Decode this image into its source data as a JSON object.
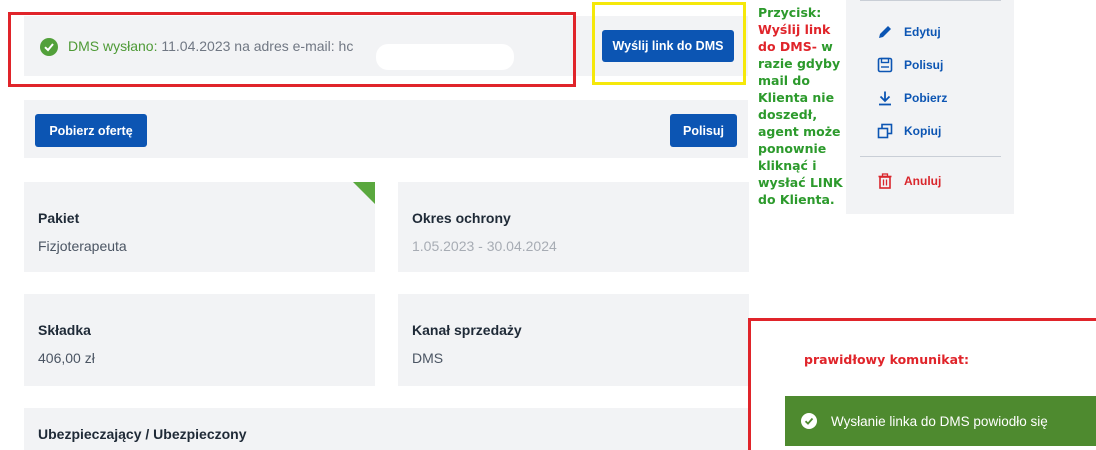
{
  "status": {
    "prefix": "DMS wysłano:",
    "text": " 11.04.2023 na adres e-mail: hc"
  },
  "buttons": {
    "send_link": "Wyślij link do DMS",
    "download_offer": "Pobierz ofertę",
    "polisuj": "Polisuj"
  },
  "cards": {
    "pakiet": {
      "label": "Pakiet",
      "value": "Fizjoterapeuta"
    },
    "okres": {
      "label": "Okres ochrony",
      "value": "1.05.2023 - 30.04.2024"
    },
    "skladka": {
      "label": "Składka",
      "value": "406,00 zł"
    },
    "kanal": {
      "label": "Kanał sprzedaży",
      "value": "DMS"
    },
    "ubezpieczajacy": {
      "label": "Ubezpieczający / Ubezpieczony"
    }
  },
  "menu": {
    "items": [
      {
        "label": "Edytuj",
        "icon": "pencil-icon"
      },
      {
        "label": "Polisuj",
        "icon": "save-icon"
      },
      {
        "label": "Pobierz",
        "icon": "download-icon"
      },
      {
        "label": "Kopiuj",
        "icon": "copy-icon"
      },
      {
        "label": "Anuluj",
        "icon": "trash-icon"
      }
    ]
  },
  "annotations": {
    "button_note_title": "Przycisk:",
    "button_note_name": "Wyślij link do DMS-",
    "button_note_text": " w razie gdyby mail do Klienta nie doszedł, agent może ponownie kliknąć i wysłać LINK do Klienta.",
    "correct_label": "prawidłowy komunikat:"
  },
  "toast": {
    "message": "Wysłanie linka do DMS powiodło się"
  },
  "colors": {
    "primary": "#0c55b3",
    "success": "#4e8a2f",
    "danger": "#d9262c",
    "annotation_red": "#e0242a",
    "annotation_yellow": "#f5e80a",
    "annotation_green": "#2c9a2c"
  }
}
